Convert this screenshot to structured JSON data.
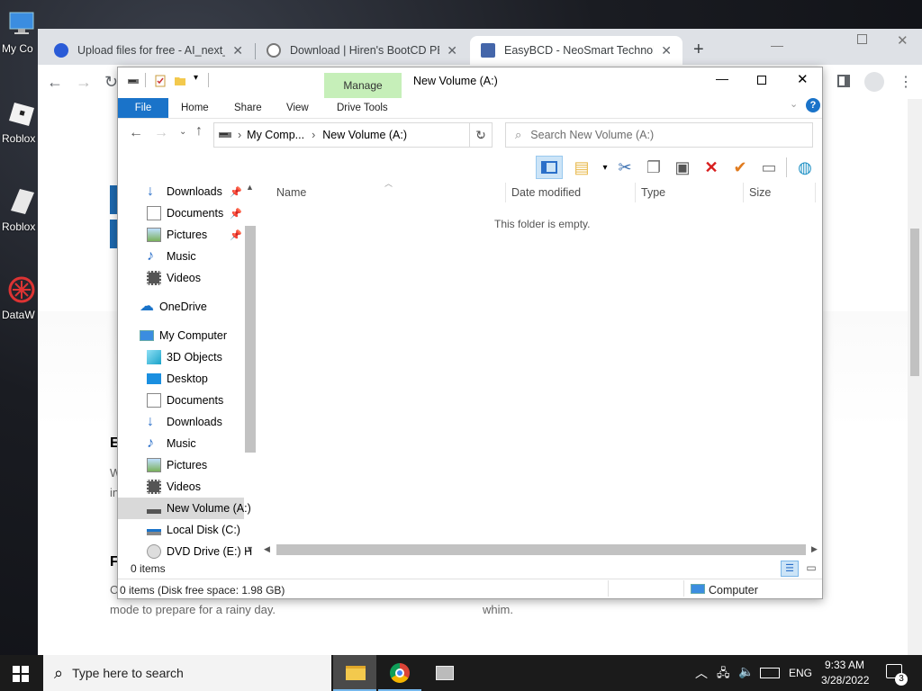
{
  "desktop": {
    "icons": [
      {
        "label": "My Co"
      },
      {
        "label": "Roblox"
      },
      {
        "label": "Roblox"
      },
      {
        "label": "DataW"
      }
    ]
  },
  "browser": {
    "tabs": [
      {
        "title": "Upload files for free - AI_next_tr"
      },
      {
        "title": "Download | Hiren's BootCD PE"
      },
      {
        "title": "EasyBCD - NeoSmart Technolog"
      }
    ],
    "new_tab": "+",
    "page_text": {
      "h1": "E",
      "p1a": "W",
      "p1b": "in",
      "h2": "F",
      "p2a": "C",
      "p2b": "mode to prepare for a rainy day.",
      "p2c": "whim."
    }
  },
  "explorer": {
    "title": "New Volume (A:)",
    "manage_label": "Manage",
    "ribbon_tabs": {
      "file": "File",
      "home": "Home",
      "share": "Share",
      "view": "View",
      "drive_tools": "Drive Tools"
    },
    "address": {
      "seg1": "My Comp...",
      "seg2": "New Volume (A:)"
    },
    "search_placeholder": "Search New Volume (A:)",
    "nav_items": {
      "downloads_q": "Downloads",
      "documents_q": "Documents",
      "pictures_q": "Pictures",
      "music_q": "Music",
      "videos_q": "Videos",
      "onedrive": "OneDrive",
      "my_computer": "My Computer",
      "objects_3d": "3D Objects",
      "desktop": "Desktop",
      "documents": "Documents",
      "downloads": "Downloads",
      "music": "Music",
      "pictures": "Pictures",
      "videos": "Videos",
      "new_volume": "New Volume (A:)",
      "local_disk": "Local Disk (C:)",
      "dvd_drive": "DVD Drive (E:) H"
    },
    "columns": {
      "name": "Name",
      "date": "Date modified",
      "type": "Type",
      "size": "Size"
    },
    "empty_message": "This folder is empty.",
    "item_count": "0 items",
    "status_left": "0 items (Disk free space: 1.98 GB)",
    "status_right": "Computer"
  },
  "taskbar": {
    "search_placeholder": "Type here to search",
    "lang": "ENG",
    "time": "9:33 AM",
    "date": "3/28/2022",
    "notifications": "3"
  }
}
